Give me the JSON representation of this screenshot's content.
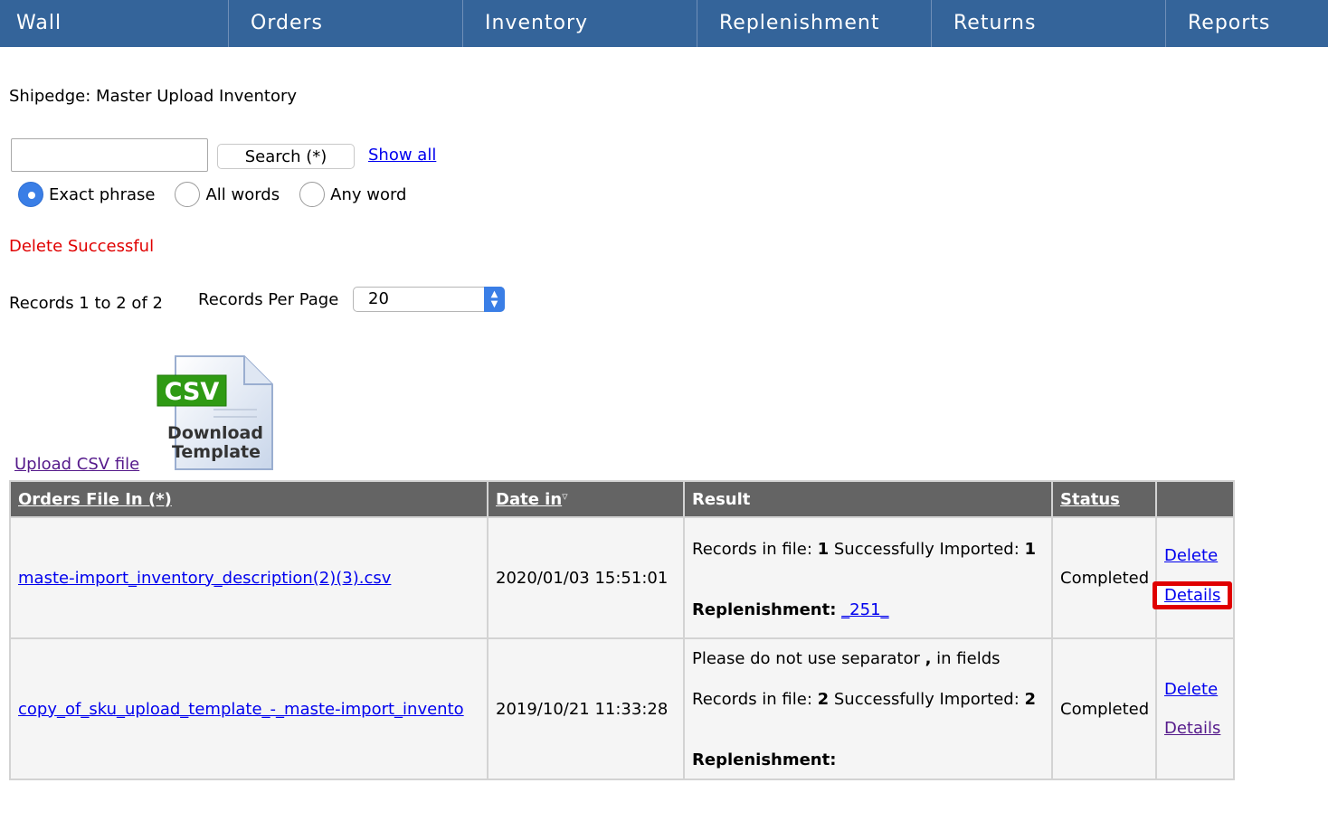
{
  "nav": [
    "Wall",
    "Orders",
    "Inventory",
    "Replenishment",
    "Returns",
    "Reports"
  ],
  "page_title": "Shipedge: Master Upload Inventory",
  "search": {
    "value": "",
    "button_label": "Search (*)",
    "show_all": "Show all",
    "options": [
      {
        "label": "Exact phrase",
        "checked": true
      },
      {
        "label": "All words",
        "checked": false
      },
      {
        "label": "Any word",
        "checked": false
      }
    ]
  },
  "status_message": "Delete Successful",
  "records": {
    "summary": "Records 1 to 2 of 2",
    "per_page_label": "Records Per Page",
    "per_page_value": "20"
  },
  "csv_icon": {
    "badge": "CSV",
    "line1": "Download",
    "line2": "Template"
  },
  "upload_link": "Upload CSV file",
  "table": {
    "headers": {
      "file": "Orders File In (*)",
      "date": "Date in",
      "result": "Result",
      "status": "Status"
    },
    "rows": [
      {
        "file": "maste-import_inventory_description(2)(3).csv",
        "date": "2020/01/03 15:51:01",
        "records_label": "Records in file: ",
        "records_value": "1",
        "imported_label": " Successfully Imported: ",
        "imported_value": "1",
        "replenishment_label": "Replenishment:",
        "replenishment_link": "_251_",
        "status": "Completed",
        "delete": "Delete",
        "details": "Details"
      },
      {
        "file": "copy_of_sku_upload_template_-_maste-import_invento",
        "date": "2019/10/21 11:33:28",
        "warning_prefix": "Please do not use separator ",
        "warning_sep": ",",
        "warning_suffix": " in fields",
        "records_label": "Records in file: ",
        "records_value": "2",
        "imported_label": " Successfully Imported: ",
        "imported_value": "2",
        "replenishment_label": "Replenishment:",
        "status": "Completed",
        "delete": "Delete",
        "details": "Details"
      }
    ]
  },
  "colors": {
    "nav_bg": "#34649a",
    "header_bg": "#646464",
    "error": "#e00000",
    "link": "#0000ee",
    "visited": "#551a8b"
  }
}
